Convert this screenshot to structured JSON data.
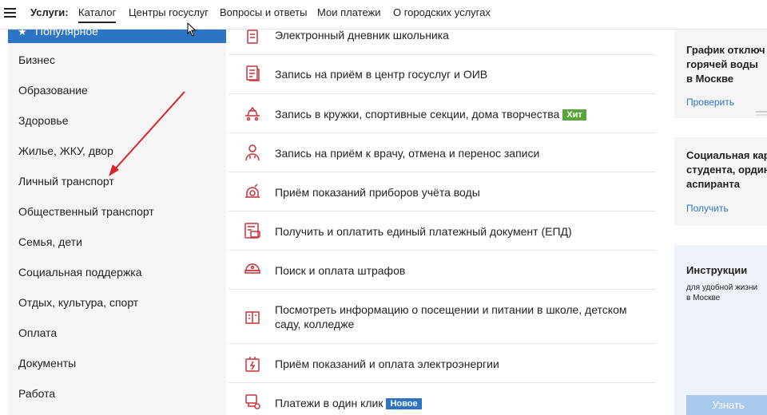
{
  "nav": {
    "title": "Услуги:",
    "items": [
      "Каталог",
      "Центры госуслуг",
      "Вопросы и ответы",
      "Мои платежи",
      "О городских услугах"
    ]
  },
  "sidebar": {
    "popular_label": "Популярное",
    "items": [
      "Бизнес",
      "Образование",
      "Здоровье",
      "Жилье, ЖКУ, двор",
      "Личный транспорт",
      "Общественный транспорт",
      "Семья, дети",
      "Социальная поддержка",
      "Отдых, культура, спорт",
      "Оплата",
      "Документы",
      "Работа"
    ]
  },
  "services": [
    {
      "text": "Электронный дневник школьника",
      "icon": "diary-icon"
    },
    {
      "text": "Запись на приём в центр госуслуг и ОИВ",
      "icon": "document-icon"
    },
    {
      "text": "Запись в кружки, спортивные секции, дома творчества",
      "badge": "Хит",
      "icon": "club-icon"
    },
    {
      "text": "Запись на приём к врачу, отмена и перенос записи",
      "icon": "doctor-icon"
    },
    {
      "text": "Приём показаний приборов учёта воды",
      "icon": "water-meter-icon"
    },
    {
      "text": "Получить и оплатить единый платежный документ (ЕПД)",
      "icon": "payment-document-icon"
    },
    {
      "text": "Поиск и оплата штрафов",
      "icon": "police-cap-icon"
    },
    {
      "text": "Посмотреть информацию о посещении и питании в школе, детском саду, колледже",
      "icon": "school-meal-icon"
    },
    {
      "text": "Приём показаний и оплата электроэнергии",
      "icon": "electricity-icon"
    },
    {
      "text": "Платежи в один клик",
      "badge": "Новое",
      "icon": "one-click-payment-icon"
    }
  ],
  "cards": {
    "hot_water": {
      "title_lines": [
        "График отключ",
        "горячей воды",
        "в Москве"
      ],
      "link": "Проверить"
    },
    "social_card": {
      "title_lines": [
        "Социальная кар",
        "студента, ордин",
        "аспиранта"
      ],
      "link": "Получить"
    },
    "instructions": {
      "title": "Инструкции",
      "subtitle_lines": [
        "для удобной жизни",
        "в Москве"
      ],
      "button": "Узнать"
    }
  },
  "colors": {
    "accent": "#2d74c4",
    "icon_red": "#c8303a",
    "hit_badge": "#5aa53a",
    "arrow": "#d9232b"
  }
}
